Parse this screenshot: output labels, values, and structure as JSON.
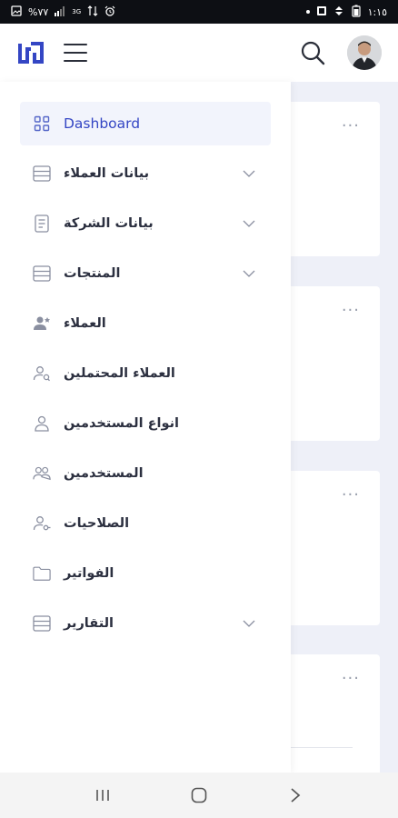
{
  "status_bar": {
    "battery": "%٧٧",
    "network": "3G",
    "time": "١:١٥"
  },
  "header": {
    "logo": "brand-logo",
    "menu_icon": "hamburger-icon",
    "search_icon": "search-icon",
    "avatar": "user-avatar"
  },
  "menu": {
    "items": [
      {
        "label": "Dashboard",
        "icon": "dashboard-grid-icon",
        "expandable": false,
        "active": true
      },
      {
        "label": "بيانات العملاء",
        "icon": "server-icon",
        "expandable": true,
        "active": false
      },
      {
        "label": "بيانات الشركة",
        "icon": "document-icon",
        "expandable": true,
        "active": false
      },
      {
        "label": "المنتجات",
        "icon": "server-icon",
        "expandable": true,
        "active": false
      },
      {
        "label": "العملاء",
        "icon": "user-star-icon",
        "expandable": false,
        "active": false
      },
      {
        "label": "العملاء المحتملين",
        "icon": "user-search-icon",
        "expandable": false,
        "active": false
      },
      {
        "label": "انواع المستخدمين",
        "icon": "user-icon",
        "expandable": false,
        "active": false
      },
      {
        "label": "المستخدمين",
        "icon": "users-icon",
        "expandable": false,
        "active": false
      },
      {
        "label": "الصلاحيات",
        "icon": "user-key-icon",
        "expandable": false,
        "active": false
      },
      {
        "label": "الفواتير",
        "icon": "folder-icon",
        "expandable": false,
        "active": false
      },
      {
        "label": "التقارير",
        "icon": "server-icon",
        "expandable": true,
        "active": false
      }
    ]
  },
  "colors": {
    "accent": "#3446c4",
    "drawer_bg": "#ffffff",
    "page_bg": "#eef0f8",
    "active_bg": "#f2f4fc"
  }
}
